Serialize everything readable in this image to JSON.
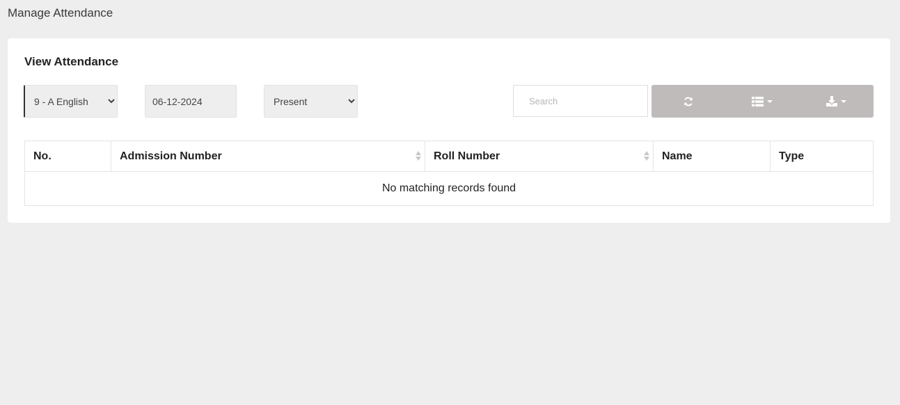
{
  "page": {
    "title": "Manage Attendance"
  },
  "card": {
    "title": "View Attendance"
  },
  "filters": {
    "class_select": {
      "value": "9 - A English",
      "options": [
        "9 - A English"
      ]
    },
    "date": {
      "value": "06-12-2024"
    },
    "status_select": {
      "value": "Present",
      "options": [
        "Present"
      ]
    }
  },
  "toolbar": {
    "search_placeholder": "Search",
    "buttons": [
      {
        "icon": "refresh-icon"
      },
      {
        "icon": "columns-list-icon"
      },
      {
        "icon": "download-icon"
      }
    ]
  },
  "table": {
    "columns": [
      "No.",
      "Admission Number",
      "Roll Number",
      "Name",
      "Type"
    ],
    "empty_message": "No matching records found"
  },
  "colors": {
    "background": "#eeeeee",
    "card": "#ffffff",
    "toolbar_buttons": "#bfbbbb"
  }
}
